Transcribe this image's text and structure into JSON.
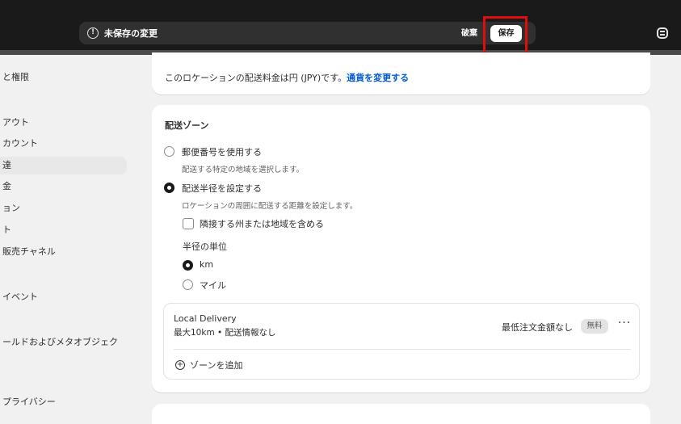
{
  "topbar": {
    "unsaved_icon": "!",
    "unsaved_label": "未保存の変更",
    "discard_label": "破棄",
    "save_label": "保存",
    "profile_icon": "store-avatar-icon"
  },
  "sidebar": {
    "items": [
      {
        "label": "と権限"
      },
      {
        "label": "アウト"
      },
      {
        "label": "カウント"
      },
      {
        "label": "達"
      },
      {
        "label": "金"
      },
      {
        "label": "ョン"
      },
      {
        "label": "ト"
      },
      {
        "label": "販売チャネル"
      },
      {
        "label": "イベント"
      },
      {
        "label": "ールドおよびメタオブジェク"
      },
      {
        "label": "プライバシー"
      }
    ]
  },
  "currency_card": {
    "text": "このロケーションの配送料金は円 (JPY)です。",
    "link": "通貨を変更する"
  },
  "zone_card": {
    "title": "配送ゾーン",
    "option_postal": "郵便番号を使用する",
    "option_postal_sub": "配送する特定の地域を選択します。",
    "option_radius": "配送半径を設定する",
    "option_radius_sub": "ロケーションの周囲に配送する距離を設定します。",
    "neighbor_checkbox": "隣接する州または地域を含める",
    "unit_title": "半径の単位",
    "unit_km": "km",
    "unit_mile": "マイル",
    "delivery": {
      "name": "Local Delivery",
      "description": "最大10km • 配送情報なし",
      "min_order": "最低注文金額なし",
      "badge": "無料",
      "more": "···"
    },
    "add_zone": "ゾーンを追加"
  }
}
